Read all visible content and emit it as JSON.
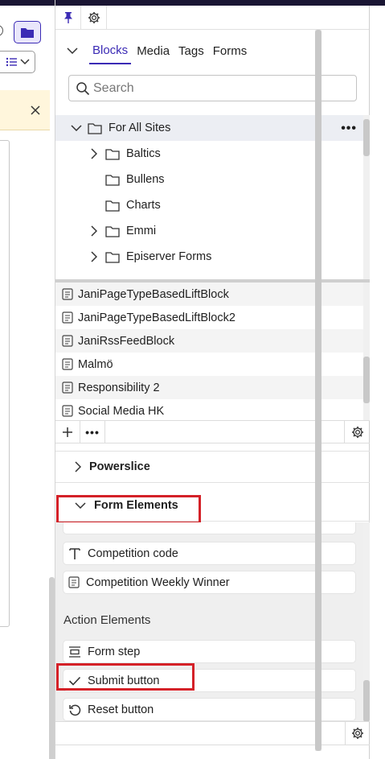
{
  "panel": {
    "tabs": [
      {
        "label": "Blocks",
        "active": true
      },
      {
        "label": "Media",
        "active": false
      },
      {
        "label": "Tags",
        "active": false
      },
      {
        "label": "Forms",
        "active": false
      }
    ],
    "search_placeholder": "Search",
    "tree": {
      "root": {
        "label": "For All Sites",
        "more": "•••"
      },
      "items": [
        {
          "label": "Baltics",
          "expandable": true
        },
        {
          "label": "Bullens",
          "expandable": false
        },
        {
          "label": "Charts",
          "expandable": false
        },
        {
          "label": "Emmi",
          "expandable": true
        },
        {
          "label": "Episerver Forms",
          "expandable": true
        }
      ]
    },
    "list_items": [
      "JaniPageTypeBasedLiftBlock",
      "JaniPageTypeBasedLiftBlock2",
      "JaniRssFeedBlock",
      "Malmö",
      "Responsibility 2",
      "Social Media HK"
    ],
    "list_toolbar": {
      "add": "+",
      "more": "•••"
    },
    "sections": {
      "powerslice": "Powerslice",
      "form_elements": "Form Elements"
    },
    "form_elements": {
      "items": [
        {
          "label": "Competition code",
          "icon": "text-t-icon"
        },
        {
          "label": "Competition Weekly Winner",
          "icon": "block-icon"
        }
      ],
      "action_heading": "Action Elements",
      "actions": [
        {
          "label": "Form step",
          "icon": "form-step-icon"
        },
        {
          "label": "Submit button",
          "icon": "checkmark-icon"
        },
        {
          "label": "Reset button",
          "icon": "reset-icon"
        }
      ]
    }
  },
  "colors": {
    "accent": "#3b2bb5",
    "highlight": "#d42128",
    "notice_bg": "#fff6dc"
  }
}
